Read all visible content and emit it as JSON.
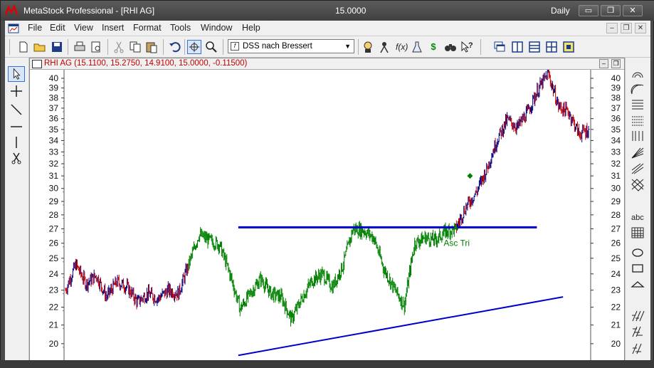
{
  "window": {
    "title": "MetaStock Professional - [RHI AG]",
    "last_price": "15.0000",
    "periodicity": "Daily",
    "minimize_glyph": "▭",
    "restore_glyph": "❐",
    "close_glyph": "✕"
  },
  "menu": {
    "items": [
      "File",
      "Edit",
      "View",
      "Insert",
      "Format",
      "Tools",
      "Window",
      "Help"
    ],
    "mdi_minimize": "–",
    "mdi_restore": "❐",
    "mdi_close": "✕"
  },
  "toolbar": {
    "indicator_select": "DSS nach Bressert",
    "formula_glyph": "f",
    "dollar_glyph": "$"
  },
  "chart": {
    "caption": "RHI AG (15.1100, 15.2750, 14.9100, 15.0000, -0.11500)",
    "pattern_label": "Asc Tri",
    "y_ticks": [
      "40",
      "39",
      "38",
      "37",
      "36",
      "35",
      "34",
      "33",
      "32",
      "31",
      "30",
      "29",
      "28",
      "27",
      "26",
      "25",
      "24",
      "23",
      "22",
      "21",
      "20"
    ],
    "colors": {
      "up": "#000080",
      "down": "#d00000",
      "pattern": "#008000",
      "trendline": "#0000cc"
    }
  },
  "chart_data": {
    "type": "line",
    "title": "RHI AG",
    "ylim": [
      19.3,
      40.6
    ],
    "y_scale": "log",
    "ohlc_last": {
      "open": 15.11,
      "high": 15.275,
      "low": 14.91,
      "close": 15.0,
      "change": -0.115
    },
    "series": [
      {
        "pattern": "Asc Tri",
        "values": [
          23.0,
          24.6,
          23.4,
          23.9,
          22.6,
          23.5,
          23.2,
          22.3,
          22.8,
          22.5,
          23.0,
          22.8,
          24.6,
          26.6,
          26.2,
          25.9,
          24.0,
          21.9,
          22.8,
          23.7,
          22.8,
          22.6,
          21.3,
          22.5,
          23.6,
          24.0,
          23.2,
          24.5,
          27.0,
          26.9,
          26.4,
          24.3,
          23.1,
          22.1,
          26.0,
          26.4,
          26.2,
          26.8,
          27.0,
          28.6,
          29.7,
          31.5,
          34.0,
          35.9,
          35.2,
          36.6,
          38.8,
          40.5,
          37.2,
          36.6,
          34.6,
          35.0
        ]
      }
    ],
    "trendlines": [
      {
        "name": "resistance",
        "from": [
          0.33,
          27.1
        ],
        "to": [
          0.9,
          27.1
        ]
      },
      {
        "name": "support",
        "from": [
          0.33,
          19.4
        ],
        "to": [
          0.95,
          22.6
        ]
      }
    ]
  }
}
